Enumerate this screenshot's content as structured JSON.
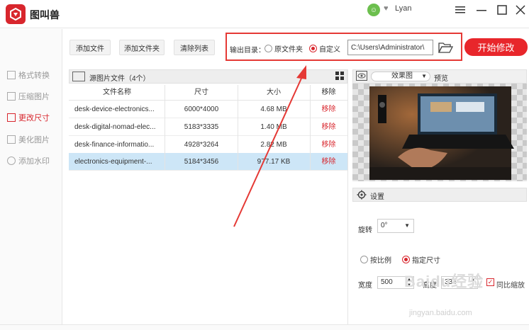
{
  "app": {
    "title": "图叫兽"
  },
  "user": {
    "name": "Lyan",
    "avatar": "☺"
  },
  "sidebar": {
    "items": [
      {
        "label": "格式转换",
        "icon": "convert-icon",
        "active": false
      },
      {
        "label": "压缩图片",
        "icon": "compress-icon",
        "active": false
      },
      {
        "label": "更改尺寸",
        "icon": "resize-icon",
        "active": true
      },
      {
        "label": "美化图片",
        "icon": "beautify-icon",
        "active": false
      },
      {
        "label": "添加水印",
        "icon": "watermark-icon",
        "active": false
      }
    ]
  },
  "toolbar": {
    "add_file": "添加文件",
    "add_folder": "添加文件夹",
    "clear_list": "清除列表",
    "output_label": "输出目录：",
    "option_original": "原文件夹",
    "option_custom": "自定义",
    "output_path": "C:\\Users\\Administrator\\",
    "start": "开始修改"
  },
  "file_list": {
    "title": "源图片文件（4个）",
    "columns": [
      "文件名称",
      "尺寸",
      "大小",
      "移除"
    ],
    "rows": [
      {
        "name": "desk-device-electronics...",
        "size": "6000*4000",
        "filesize": "4.68 MB",
        "remove": "移除",
        "selected": false
      },
      {
        "name": "desk-digital-nomad-elec...",
        "size": "5183*3335",
        "filesize": "1.40 MB",
        "remove": "移除",
        "selected": false
      },
      {
        "name": "desk-finance-informatio...",
        "size": "4928*3264",
        "filesize": "2.82 MB",
        "remove": "移除",
        "selected": false
      },
      {
        "name": "electronics-equipment-...",
        "size": "5184*3456",
        "filesize": "977.17 KB",
        "remove": "移除",
        "selected": true
      }
    ]
  },
  "preview": {
    "mode": "效果图",
    "label": "预览"
  },
  "settings": {
    "title": "设置",
    "rotate_label": "旋转",
    "rotate_value": "0°",
    "option_ratio": "按比例",
    "option_size": "指定尺寸",
    "width_label": "宽度",
    "width_value": "500",
    "height_label": "高度",
    "height_value": "334",
    "lock_ratio": "同比缩放"
  },
  "watermark": {
    "brand": "Baidu经验",
    "url": "jingyan.baidu.com"
  },
  "colors": {
    "accent": "#d8262d",
    "selected_row": "#cde6f7",
    "annotation": "#e53935"
  }
}
